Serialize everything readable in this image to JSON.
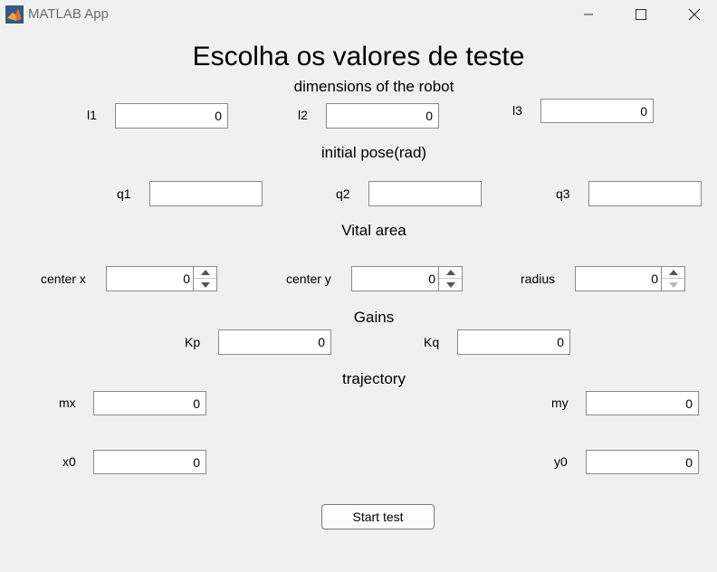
{
  "window": {
    "title": "MATLAB App",
    "app_icon": "matlab-logo-icon",
    "controls": [
      "minimize-icon",
      "maximize-icon",
      "close-icon"
    ]
  },
  "main_title": "Escolha os valores de teste",
  "dimensions": {
    "heading": "dimensions of the robot",
    "l1": {
      "label": "l1",
      "value": "0"
    },
    "l2": {
      "label": "l2",
      "value": "0"
    },
    "l3": {
      "label": "l3",
      "value": "0"
    }
  },
  "initial_pose": {
    "heading": "initial pose(rad)",
    "q1": {
      "label": "q1",
      "value": ""
    },
    "q2": {
      "label": "q2",
      "value": ""
    },
    "q3": {
      "label": "q3",
      "value": ""
    }
  },
  "vital_area": {
    "heading": "Vital area",
    "center_x": {
      "label": "center x",
      "value": "0"
    },
    "center_y": {
      "label": "center y",
      "value": "0"
    },
    "radius": {
      "label": "radius",
      "value": "0"
    }
  },
  "gains": {
    "heading": "Gains",
    "kp": {
      "label": "Kp",
      "value": "0"
    },
    "kq": {
      "label": "Kq",
      "value": "0"
    }
  },
  "trajectory": {
    "heading": "trajectory",
    "mx": {
      "label": "mx",
      "value": "0"
    },
    "my": {
      "label": "my",
      "value": "0"
    },
    "x0": {
      "label": "x0",
      "value": "0"
    },
    "y0": {
      "label": "y0",
      "value": "0"
    }
  },
  "start_button": {
    "label": "Start test"
  },
  "colors": {
    "background": "#f0f0f0",
    "field_border": "#8a8a8a",
    "text": "#000000"
  }
}
